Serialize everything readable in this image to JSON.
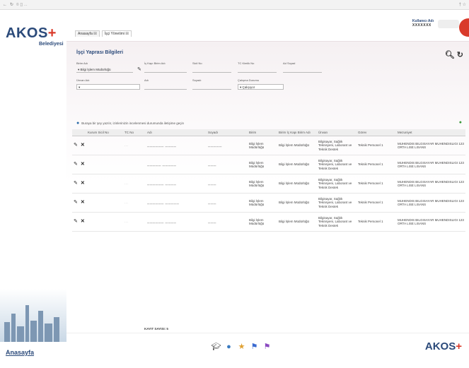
{
  "browser": {
    "url": "© [] ...",
    "right": "† ☆"
  },
  "app": {
    "logo_text": "AKOS",
    "logo_plus": "+",
    "logo_sub": "Belediyesi",
    "home_link": "Anasayfa"
  },
  "topbar": {
    "tabs": [
      {
        "label": "Anasayfa ☒"
      },
      {
        "label": "İşçi Yönetimi ☒"
      }
    ],
    "user_name": "Kullanıcı Adı",
    "user_id": "XXXXXXX"
  },
  "form": {
    "title": "İşçi Yaprası Bilgileri",
    "fields": {
      "birim_label": "Birim Adı",
      "birim_value": "▾ Bilgi İşlem Müdürlüğü",
      "ic_kapi_label": "İç Kapı Birim Adı",
      "sicil_label": "Sicil No",
      "tc_label": "TC Kimlik No",
      "ad_soyad_label": "Ad Soyad",
      "unvan_label": "Ünvan Adı",
      "unvan_value": "▾",
      "adi_label": "Adı",
      "soyadi_label": "Soyadı",
      "calisma_label": "Çalışma Durumu",
      "calisma_value": "▾ Çalışıyor"
    },
    "info_text": "Buraya bir şey yazılır, izinlerinizin incelenmesi durumunda iletişime geçin"
  },
  "table": {
    "headers": [
      "",
      "Kurum Sicil No",
      "TC No",
      "Adı",
      "Soyadı",
      "Birim",
      "Birim İç Kapı Birim Adı",
      "Ünvan",
      "Görev",
      "Mezuniyet"
    ],
    "rows": [
      {
        "sicil": "",
        "tc": "...",
        "adi": "▁▁▁▁▁▁ ▁▁▁▁",
        "soyadi": "▁▁▁▁▁",
        "birim": "Bilgi İşlem Müdürlüğü",
        "ic_kapi": "Bilgi İşlem Müdürlüğü",
        "unvan": "Bilgisayar, Sağlık Teknisyeni, Laborant ve Teknik Destek",
        "gorev": "Teknik Personel 1",
        "mezuniyet": "MUHENDIS BILGISAYAR MUHENDISLIGI 123 ORTA LISE LISANS"
      },
      {
        "sicil": "",
        "tc": "",
        "adi": "▁▁▁▁▁ ▁▁▁▁▁",
        "soyadi": "▁▁▁",
        "birim": "Bilgi İşlem Müdürlüğü",
        "ic_kapi": "Bilgi İşlem Müdürlüğü",
        "unvan": "Bilgisayar, Sağlık Teknisyeni, Laborant ve Teknik Destek",
        "gorev": "Teknik Personel 1",
        "mezuniyet": "MUHENDIS BILGISAYAR MUHENDISLIGI 123 ORTA LISE LISANS"
      },
      {
        "sicil": "",
        "tc": "...",
        "adi": "▁▁▁▁▁▁ ▁▁▁▁",
        "soyadi": "▁▁▁",
        "birim": "Bilgi İşlem Müdürlüğü",
        "ic_kapi": "Bilgi İşlem Müdürlüğü",
        "unvan": "Bilgisayar, Sağlık Teknisyeni, Laborant ve Teknik Destek",
        "gorev": "Teknik Personel 1",
        "mezuniyet": "MUHENDIS BILGISAYAR MUHENDISLIGI 123 ORTA LISE LISANS"
      },
      {
        "sicil": "",
        "tc": "...",
        "adi": "▁▁▁▁▁▁ ▁▁▁▁▁",
        "soyadi": "▁▁▁",
        "birim": "Bilgi İşlem Müdürlüğü",
        "ic_kapi": "Bilgi İşlem Müdürlüğü",
        "unvan": "Bilgisayar, Sağlık Teknisyeni, Laborant ve Teknik Destek",
        "gorev": "Teknik Personel 1",
        "mezuniyet": "MUHENDIS BILGISAYAR MUHENDISLIGI 123 ORTA LISE LISANS"
      },
      {
        "sicil": "",
        "tc": "...",
        "adi": "▁▁▁▁▁▁ ▁▁▁▁",
        "soyadi": "▁▁▁",
        "birim": "Bilgi İşlem Müdürlüğü",
        "ic_kapi": "Bilgi İşlem Müdürlüğü",
        "unvan": "Bilgisayar, Sağlık Teknisyeni, Laborant ve Teknik Destek",
        "gorev": "Teknik Personel 1",
        "mezuniyet": "MUHENDIS BILGISAYAR MUHENDISLIGI 123 ORTA LISE LISANS"
      }
    ]
  },
  "footer_note": "KAYIT SAYISI: 5",
  "bottom": {
    "logo_text": "AKOS",
    "logo_plus": "+"
  },
  "icons": {
    "search": "search-icon",
    "refresh": "refresh-icon",
    "edit": "pencil-icon",
    "delete": "x-icon"
  },
  "colors": {
    "brand": "#2b4a7a",
    "accent": "#d93a2a"
  }
}
